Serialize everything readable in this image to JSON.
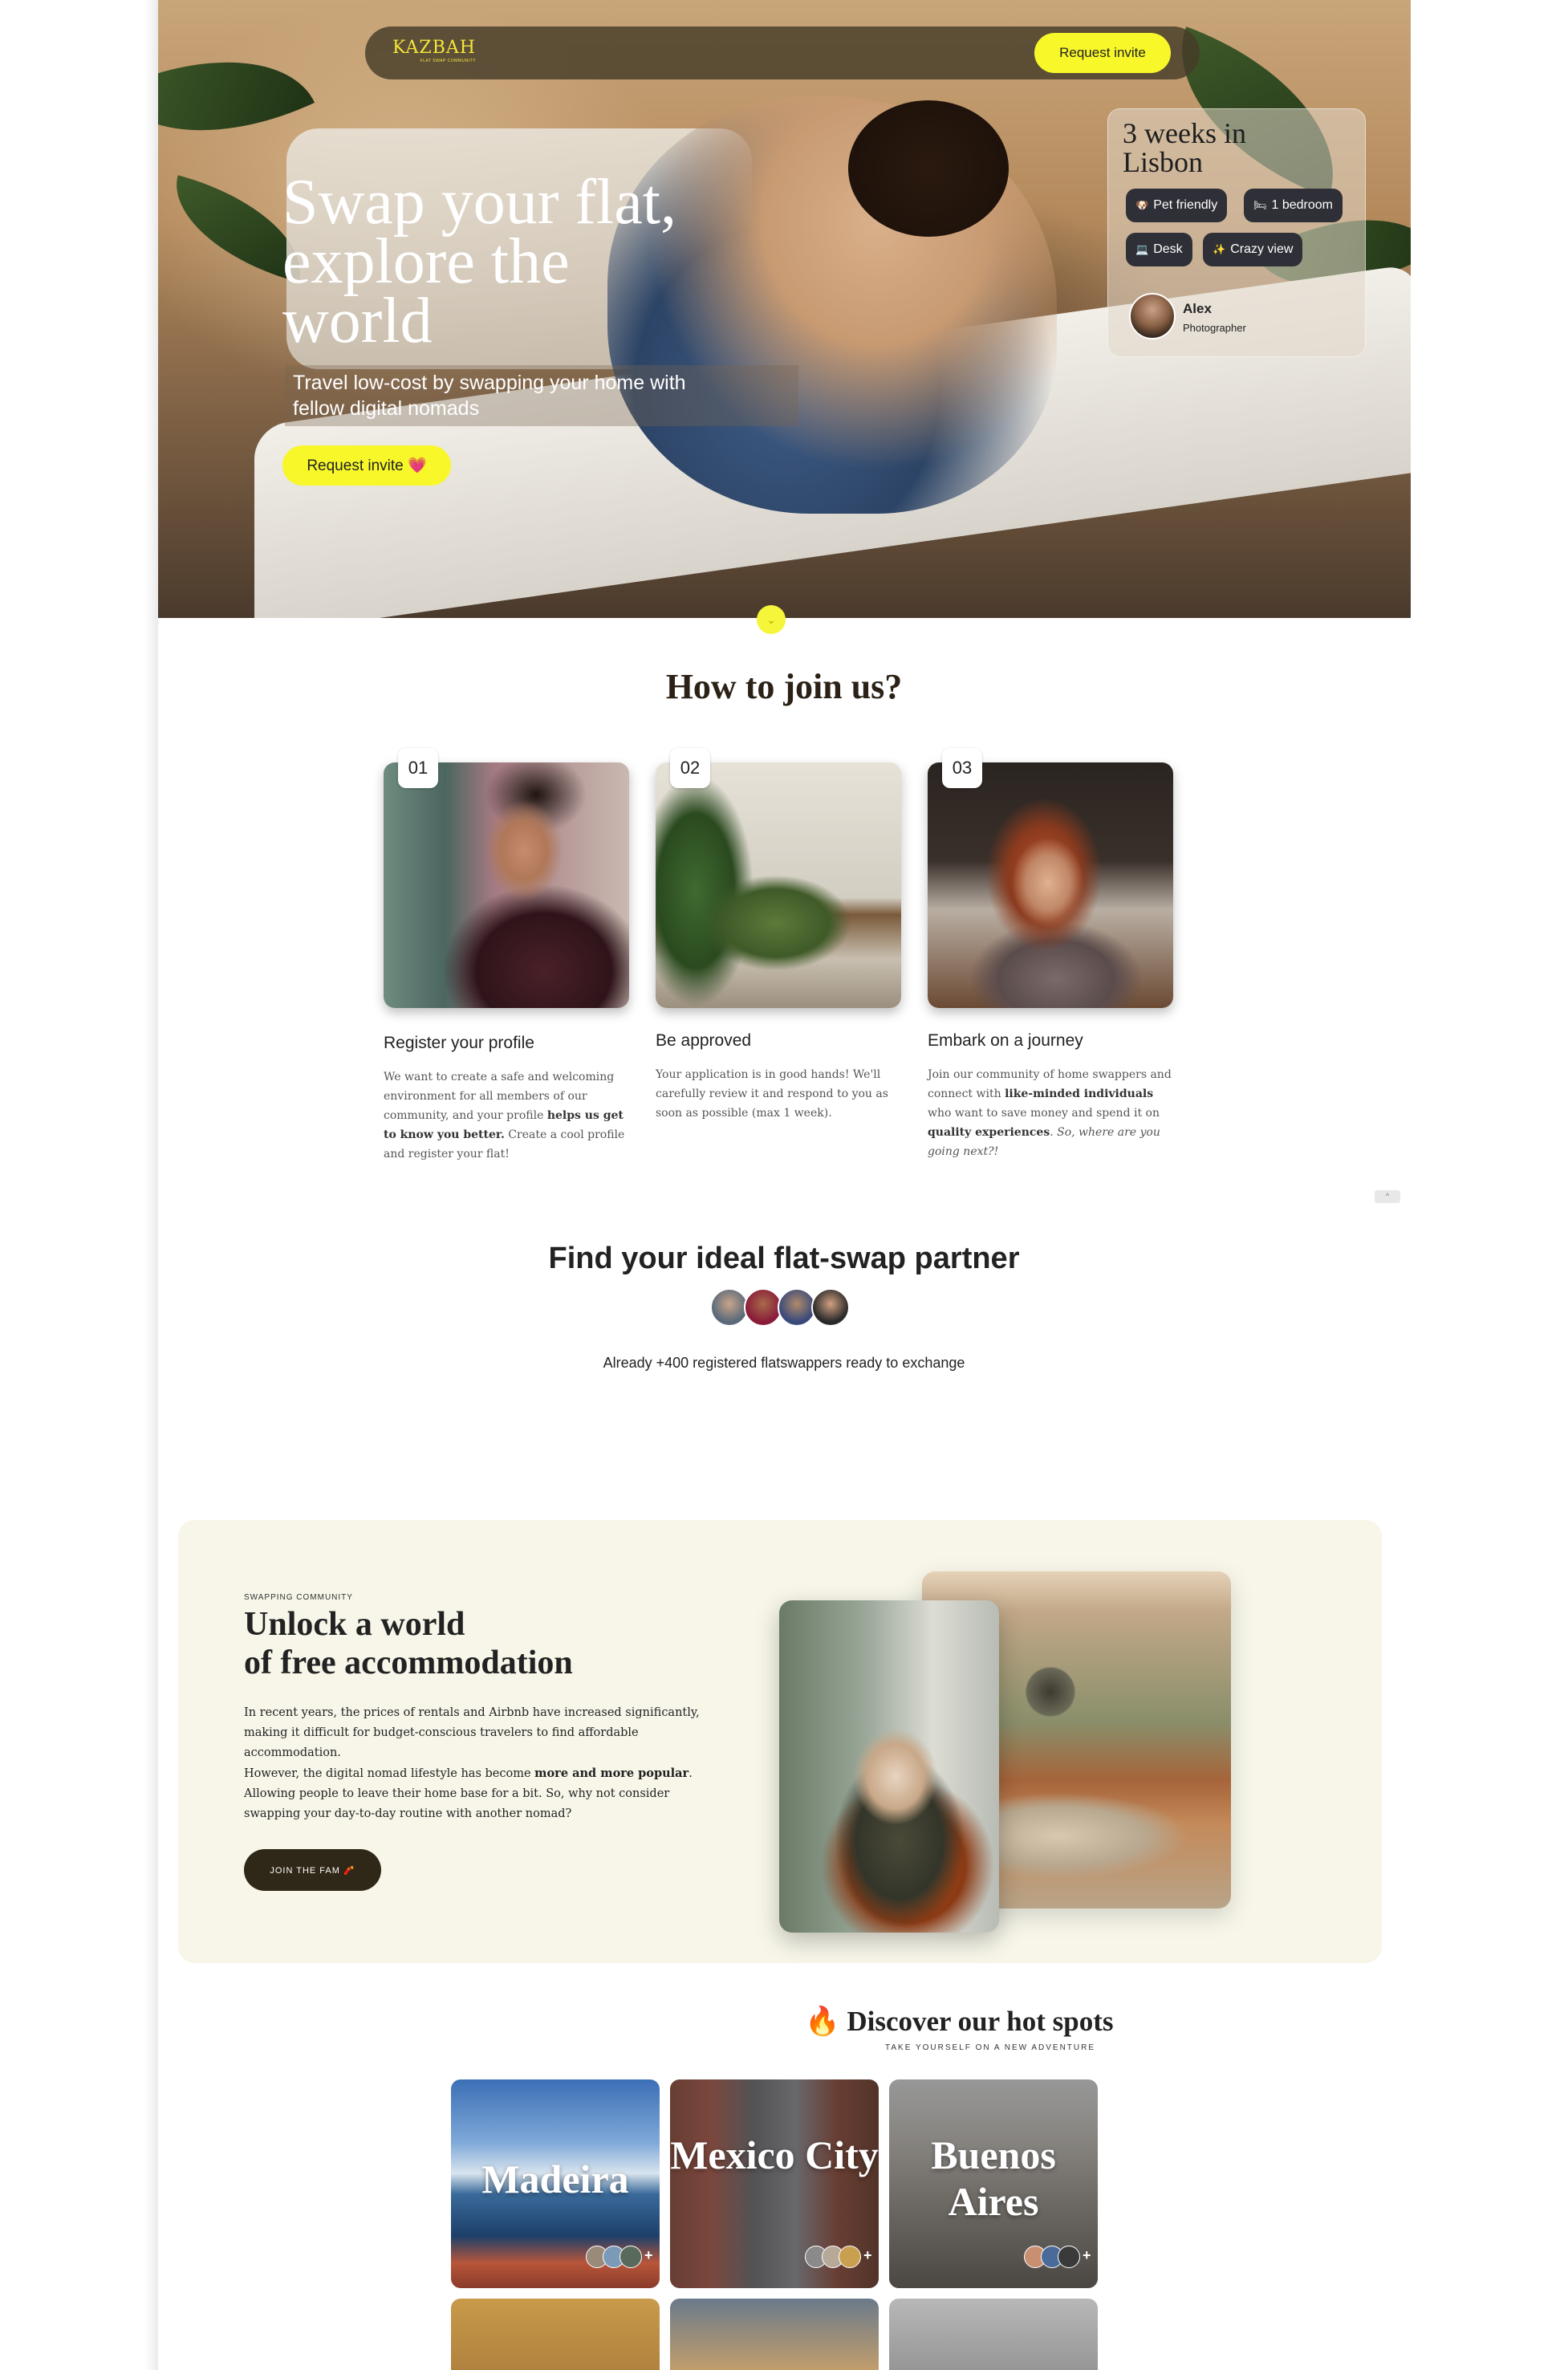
{
  "nav": {
    "logo": "KAZBAH",
    "logo_tagline": "FLAT SWAP COMMUNITY",
    "request_invite": "Request invite"
  },
  "hero": {
    "title": "Swap your flat,\nexplore the\nworld",
    "subtitle": "Travel low-cost by swapping your home with\nfellow digital nomads",
    "cta": "Request invite 💗"
  },
  "listing_card": {
    "title": "3 weeks in\nLisbon",
    "tags": [
      {
        "icon": "🐶",
        "label": "Pet friendly"
      },
      {
        "icon": "🛏",
        "label": "1 bedroom"
      },
      {
        "icon": "💻",
        "label": "Desk"
      },
      {
        "icon": "✨",
        "label": "Crazy view"
      }
    ],
    "host_name": "Alex",
    "host_role": "Photographer"
  },
  "how_to_join": {
    "title": "How to join us?",
    "steps": [
      {
        "number": "01",
        "title": "Register your profile",
        "desc_parts": [
          "We want to create a safe and welcoming environment for all members of our community, and your profile ",
          "helps us get to know you better.",
          " Create a cool profile and register your flat!"
        ]
      },
      {
        "number": "02",
        "title": "Be approved",
        "desc": "Your application is in good hands! We'll carefully review it and respond to you as soon as possible (max 1 week)."
      },
      {
        "number": "03",
        "title": "Embark on a journey",
        "desc_parts": [
          "Join our community of home swappers and connect with ",
          "like-minded individuals",
          " who want to save money and spend it on ",
          "quality experiences",
          ". ",
          "So, where are you going next?!"
        ]
      }
    ]
  },
  "find_partner": {
    "title": "Find your ideal flat-swap partner",
    "subtitle": "Already +400 registered flatswappers ready to exchange"
  },
  "unlock": {
    "eyebrow": "SWAPPING COMMUNITY",
    "title": "Unlock a world\nof free accommodation",
    "p1": "In recent years, the prices of rentals and Airbnb have increased significantly, making it difficult for budget-conscious travelers to find affordable accommodation.",
    "p2_before": "However, the digital nomad lifestyle has become ",
    "p2_bold": "more and more popular",
    "p2_after": ". Allowing people to leave their home base for a bit. So, why not consider swapping your day-to-day routine with another nomad?",
    "cta": "JOIN THE FAM 🧨"
  },
  "hot_spots": {
    "title": "🔥 Discover our hot spots",
    "subtitle": "TAKE YOURSELF ON A NEW ADVENTURE",
    "cities": [
      {
        "name": "Madeira"
      },
      {
        "name": "Mexico City"
      },
      {
        "name": "Buenos Aires"
      }
    ]
  },
  "misc": {
    "scroll_hint": "⌄",
    "back_to_top": "^"
  },
  "colors": {
    "accent_yellow": "#f7f72a",
    "dark_brown": "#2f2717",
    "cream_bg": "#f7f6e9",
    "tag_bg": "#2f3037"
  }
}
